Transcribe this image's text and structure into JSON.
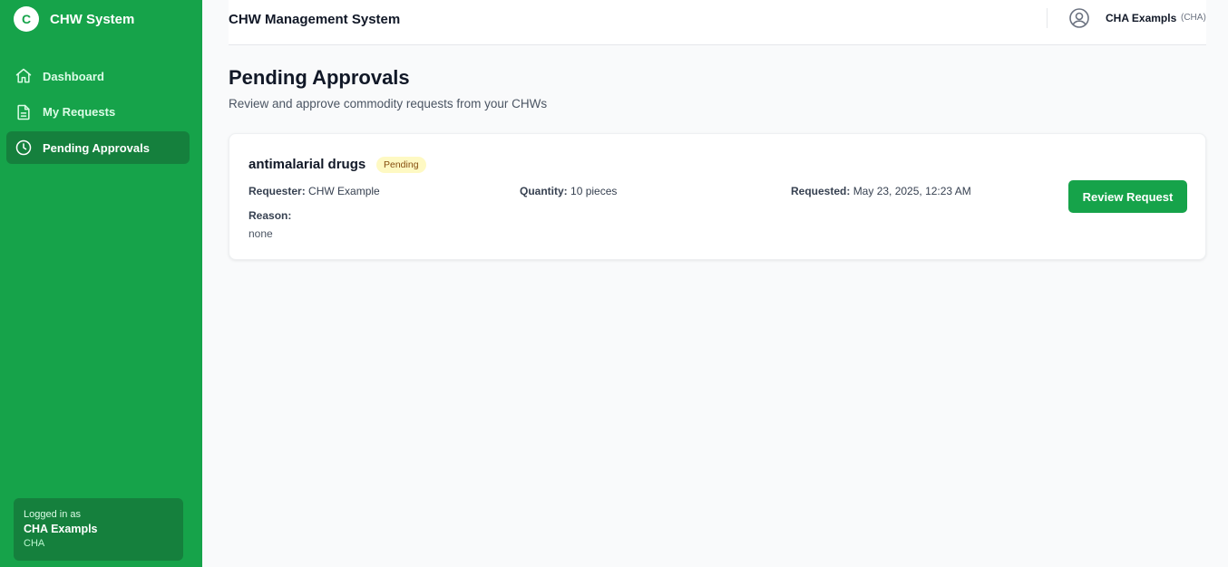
{
  "app": {
    "logo_letter": "C",
    "name": "CHW System",
    "brand_color": "#16a34a"
  },
  "sidebar": {
    "items": [
      {
        "label": "Dashboard",
        "icon": "home-icon",
        "active": false
      },
      {
        "label": "My Requests",
        "icon": "document-icon",
        "active": false
      },
      {
        "label": "Pending Approvals",
        "icon": "clock-icon",
        "active": true
      }
    ],
    "user": {
      "logged_in_label": "Logged in as",
      "name": "CHA Exampls",
      "role": "CHA"
    }
  },
  "header": {
    "title": "CHW Management System",
    "user_icon": "user-circle-icon",
    "user_name": "CHA Exampls",
    "user_role": "(CHA)"
  },
  "page": {
    "title": "Pending Approvals",
    "subtitle": "Review and approve commodity requests from your CHWs"
  },
  "requests": [
    {
      "item": "antimalarial drugs",
      "status": "Pending",
      "requester_label": "Requester:",
      "requester": "CHW Example",
      "quantity_label": "Quantity:",
      "quantity": "10 pieces",
      "requested_label": "Requested:",
      "requested": "May 23, 2025, 12:23 AM",
      "reason_label": "Reason:",
      "reason": "none",
      "action_label": "Review Request"
    }
  ]
}
